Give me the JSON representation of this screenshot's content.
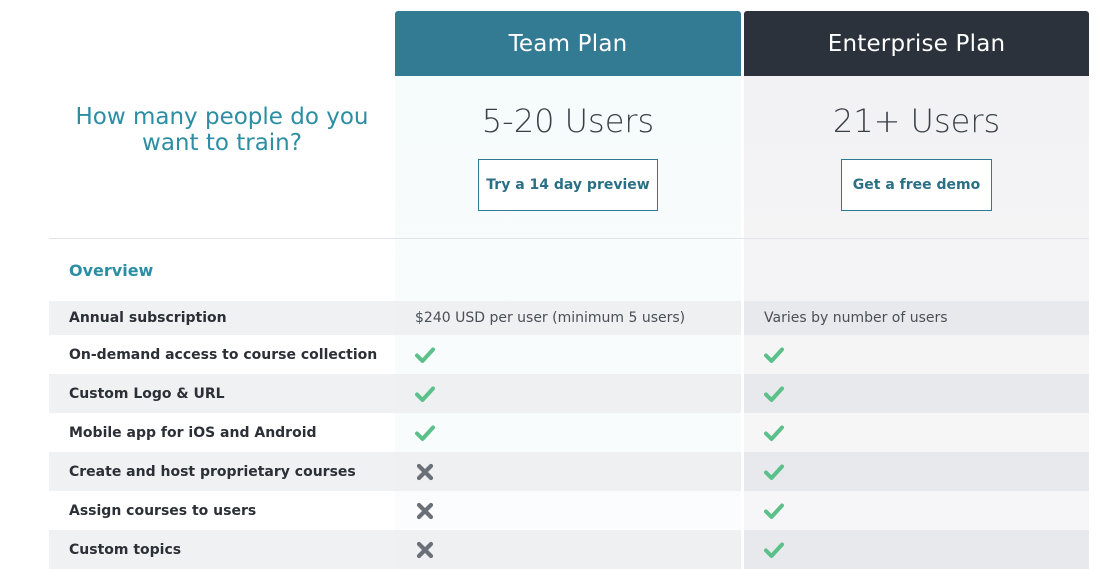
{
  "plans": {
    "team": {
      "title": "Team Plan",
      "users": "5-20 Users",
      "cta": "Try a 14 day preview"
    },
    "enterprise": {
      "title": "Enterprise Plan",
      "users": "21+ Users",
      "cta": "Get a free demo"
    }
  },
  "question": "How many people do you want to train?",
  "section_title": "Overview",
  "rows": [
    {
      "label": "Annual subscription",
      "team": "$240 USD per user (minimum 5 users)",
      "enterprise": "Varies by number of users"
    },
    {
      "label": "On-demand access to course collection",
      "team_icon": "check-icon",
      "enterprise_icon": "check-icon"
    },
    {
      "label": "Custom Logo & URL",
      "team_icon": "check-icon",
      "enterprise_icon": "check-icon"
    },
    {
      "label": "Mobile app for iOS and Android",
      "team_icon": "check-icon",
      "enterprise_icon": "check-icon"
    },
    {
      "label": "Create and host proprietary courses",
      "team_icon": "cross-icon",
      "enterprise_icon": "check-icon"
    },
    {
      "label": "Assign courses to users",
      "team_icon": "cross-icon",
      "enterprise_icon": "check-icon"
    },
    {
      "label": "Custom topics",
      "team_icon": "cross-icon",
      "enterprise_icon": "check-icon"
    }
  ],
  "colors": {
    "team_header": "#337a93",
    "enterprise_header": "#2c323b",
    "accent": "#2b8ea3",
    "check": "#5cc08a",
    "cross": "#6b7078"
  }
}
